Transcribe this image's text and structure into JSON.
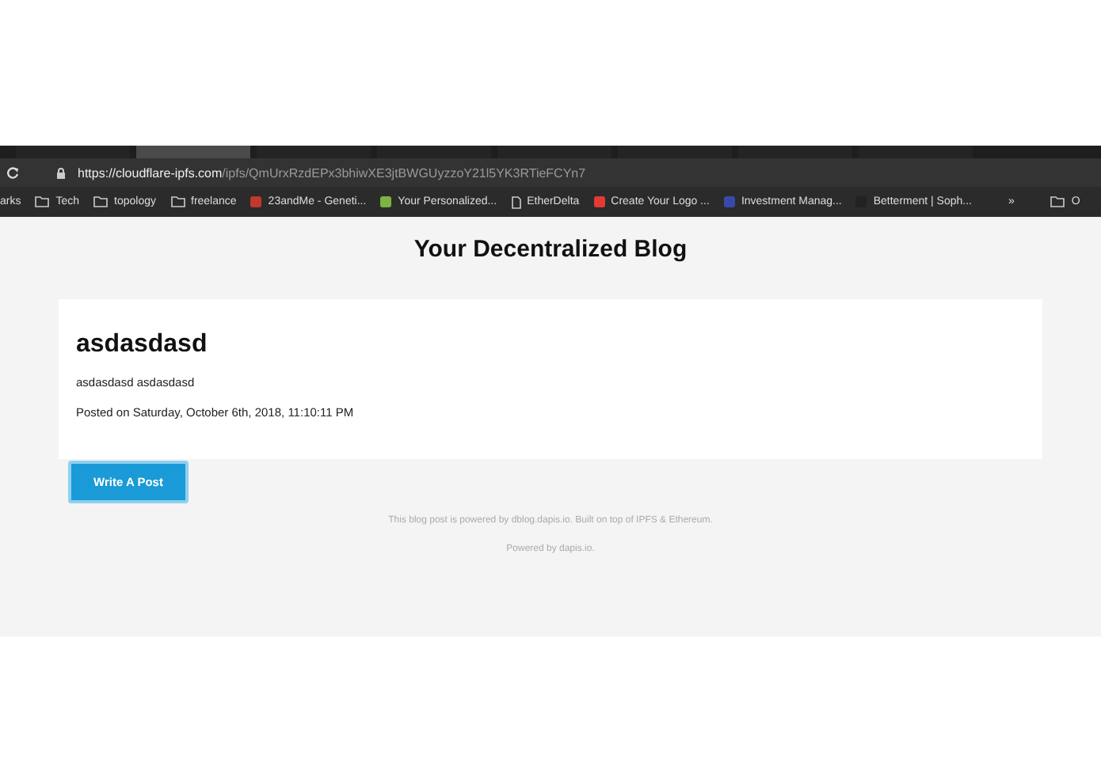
{
  "browser": {
    "tabs": [
      {
        "selected": false
      },
      {
        "selected": true
      },
      {
        "selected": false
      },
      {
        "selected": false
      },
      {
        "selected": false
      },
      {
        "selected": false
      },
      {
        "selected": false
      },
      {
        "selected": false
      }
    ],
    "url_host": "https://cloudflare-ipfs.com",
    "url_path": "/ipfs/QmUrxRzdEPx3bhiwXE3jtBWGUyzzoY21l5YK3RTieFCYn7",
    "bookmarks": [
      {
        "kind": "text",
        "label": "arks"
      },
      {
        "kind": "folder",
        "label": "Tech"
      },
      {
        "kind": "folder",
        "label": "topology"
      },
      {
        "kind": "folder",
        "label": "freelance"
      },
      {
        "kind": "site",
        "label": "23andMe - Geneti...",
        "color": "#c0392b"
      },
      {
        "kind": "site",
        "label": "Your Personalized...",
        "color": "#7cb342"
      },
      {
        "kind": "page",
        "label": "EtherDelta"
      },
      {
        "kind": "site",
        "label": "Create Your Logo ...",
        "color": "#e53935"
      },
      {
        "kind": "site",
        "label": "Investment Manag...",
        "color": "#3949ab"
      },
      {
        "kind": "site",
        "label": "Betterment | Soph...",
        "color": "#222222"
      },
      {
        "kind": "text",
        "label": "»"
      },
      {
        "kind": "folder",
        "label": "O"
      }
    ]
  },
  "blog": {
    "title": "Your Decentralized Blog",
    "post": {
      "title": "asdasdasd",
      "body": "asdasdasd asdasdasd",
      "posted": "Posted on Saturday, October 6th, 2018, 11:10:11 PM"
    },
    "button": "Write A Post",
    "footer": [
      "This blog post is powered by dblog.dapis.io. Built on top of IPFS & Ethereum.",
      "Powered by dapis.io."
    ]
  }
}
